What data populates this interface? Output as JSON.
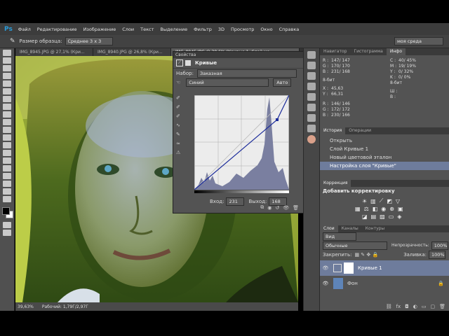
{
  "app": {
    "logo": "Ps"
  },
  "menu": [
    "Файл",
    "Редактирование",
    "Изображение",
    "Слои",
    "Текст",
    "Выделение",
    "Фильтр",
    "3D",
    "Просмотр",
    "Окно",
    "Справка"
  ],
  "options": {
    "sample_label": "Размер образца:",
    "sample_value": "Среднее 3 х 3",
    "workspace": "моя среда"
  },
  "doc_tabs": [
    "IMG_8945.JPG @ 27,1% (Кри...",
    "IMG_8940.JPG @ 26,8% (Кри...",
    "IMG_8945.JPG @ 39,6% (Кривые 1, Слой-ма..."
  ],
  "status": {
    "zoom": "39,63%",
    "doc": "Рабочий: 1,79Г/2,97Г"
  },
  "properties": {
    "tab": "Свойства",
    "title": "Кривые",
    "preset_label": "Набор:",
    "preset_value": "Заказная",
    "channel": "Синий",
    "auto": "Авто",
    "input_label": "Вход:",
    "input_value": "231",
    "output_label": "Выход:",
    "output_value": "168"
  },
  "info": {
    "tabs": [
      "Навигатор",
      "Гистограмма",
      "Инфо"
    ],
    "r": "147/ 147",
    "g": "170/ 170",
    "b": "231/ 168",
    "bit1": "8-бит",
    "c": "40/ 45%",
    "m": "19/ 19%",
    "y": "0/ 32%",
    "k": "0/ 0%",
    "bit2": "8-бит",
    "x": "45,63",
    "yv": "66,31",
    "w": "",
    "h": "",
    "r2": "146/ 146",
    "g2": "172/ 172",
    "b2": "230/ 166"
  },
  "history": {
    "tabs": [
      "История",
      "Операции"
    ],
    "items": [
      "Открыть",
      "Слой Кривые 1",
      "Новый цветовой эталон",
      "Настройка слоя \"Кривые\""
    ]
  },
  "adjustments": {
    "tab": "Коррекция",
    "title": "Добавить корректировку"
  },
  "layers": {
    "tabs": [
      "Слои",
      "Каналы",
      "Контуры"
    ],
    "kind": "Вид",
    "blend": "Обычные",
    "opacity_label": "Непрозрачность:",
    "opacity": "100%",
    "lock_label": "Закрепить:",
    "fill_label": "Заливка:",
    "fill": "100%",
    "items": [
      "Кривые 1",
      "Фон"
    ]
  }
}
